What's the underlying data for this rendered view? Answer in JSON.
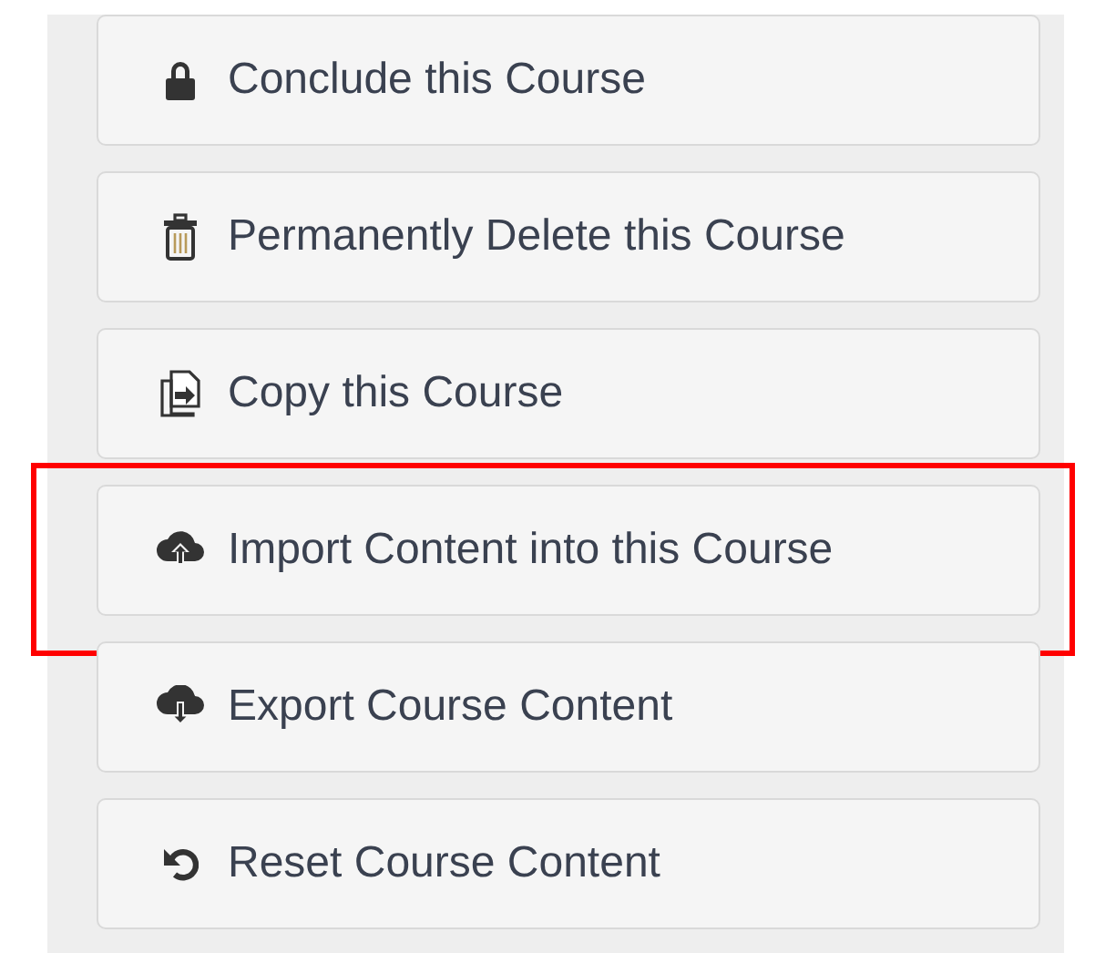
{
  "actions": [
    {
      "kind": "lock",
      "label": "Conclude this Course",
      "highlighted": false
    },
    {
      "kind": "trash",
      "label": "Permanently Delete this Course",
      "highlighted": false
    },
    {
      "kind": "copy",
      "label": "Copy this Course",
      "highlighted": false
    },
    {
      "kind": "upload",
      "label": "Import Content into this Course",
      "highlighted": true
    },
    {
      "kind": "download",
      "label": "Export Course Content",
      "highlighted": false
    },
    {
      "kind": "reset",
      "label": "Reset Course Content",
      "highlighted": false
    }
  ]
}
